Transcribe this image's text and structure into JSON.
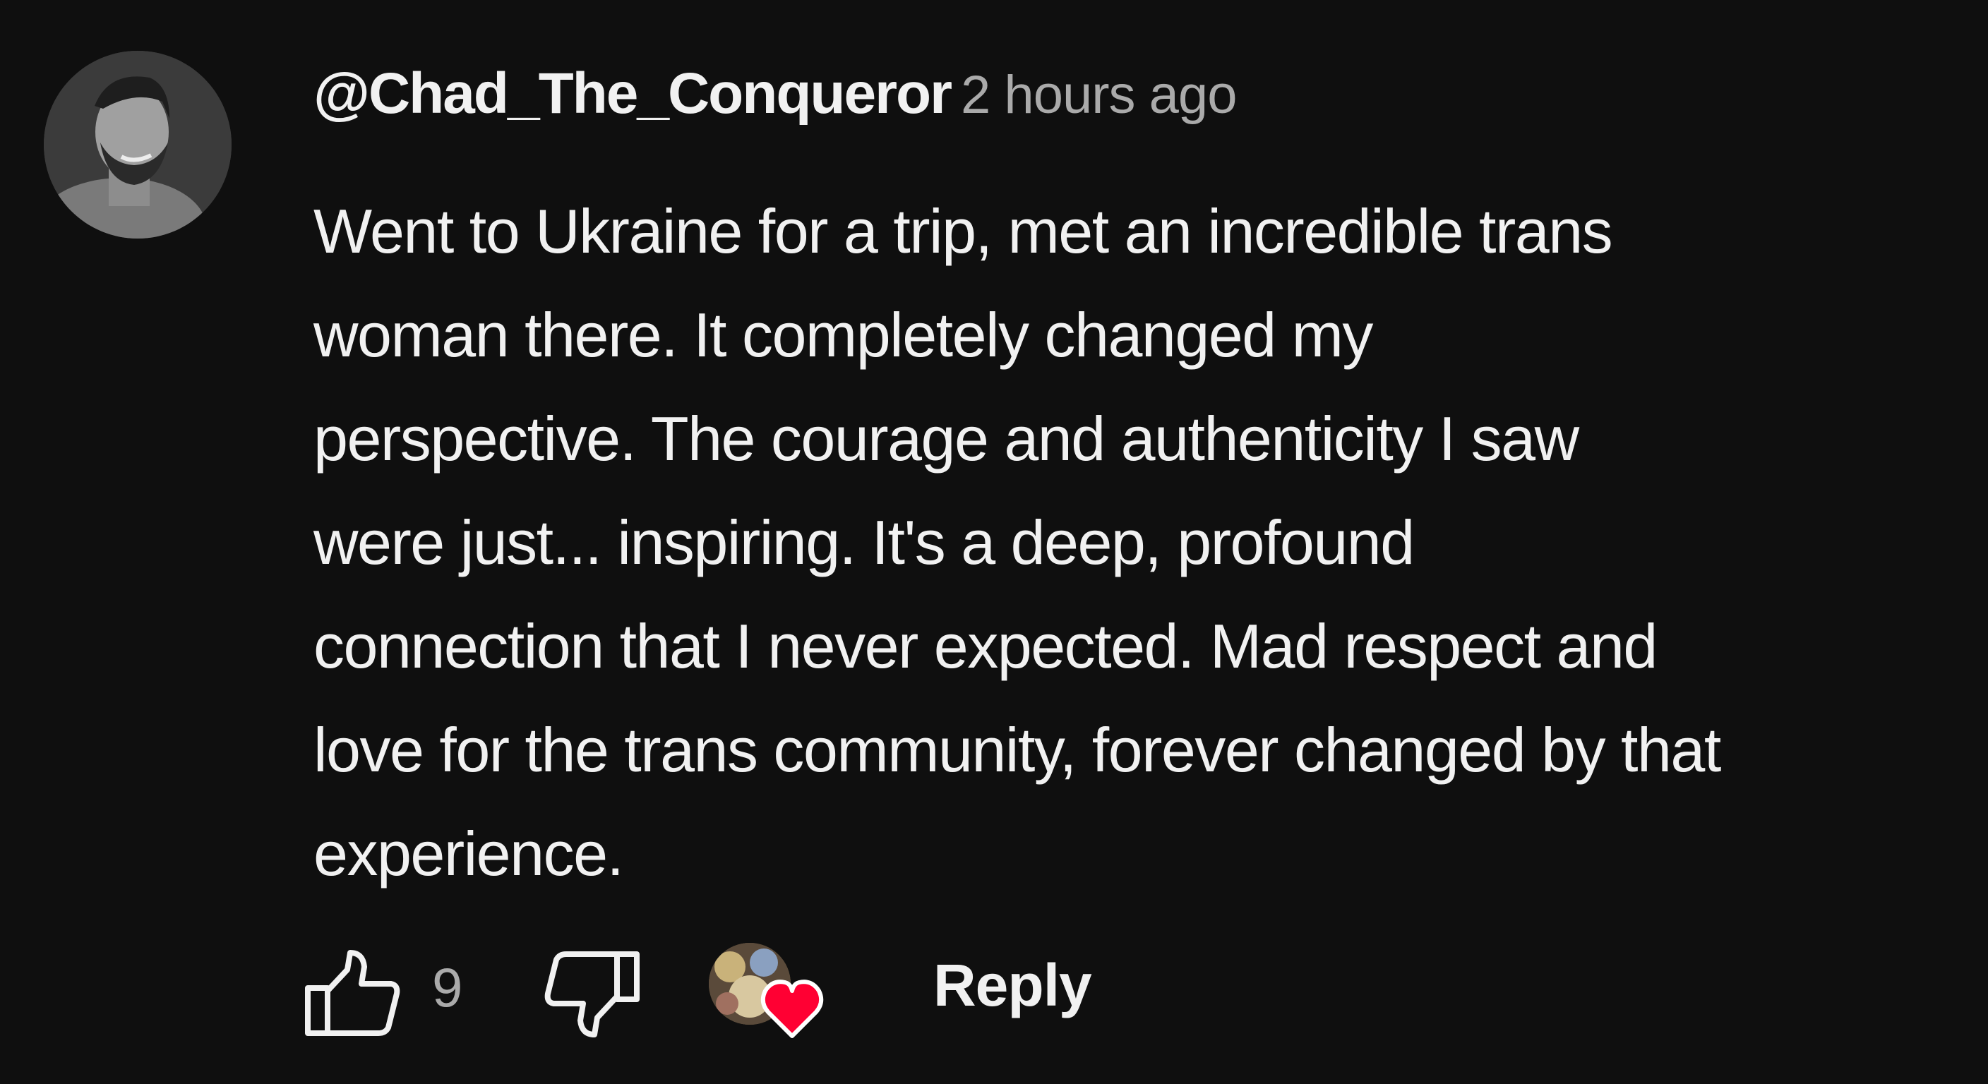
{
  "comment": {
    "author": "@Chad_The_Conqueror",
    "timestamp": "2 hours ago",
    "body_lines": [
      "Went to Ukraine for a trip, met an incredible trans",
      "woman there. It completely changed my",
      "perspective. The courage and authenticity I saw",
      "were just... inspiring. It's a deep, profound",
      "connection that I never expected. Mad respect and",
      "love for the trans community, forever changed by that",
      "experience."
    ]
  },
  "actions": {
    "like_icon": "thumbs-up-icon",
    "like_count": "9",
    "dislike_icon": "thumbs-down-icon",
    "creator_heart_icon": "heart-icon",
    "reply_label": "Reply"
  },
  "colors": {
    "background": "#0f0f0f",
    "text_primary": "#f1f1f1",
    "text_secondary": "#aaaaaa",
    "heart": "#ff0033"
  }
}
